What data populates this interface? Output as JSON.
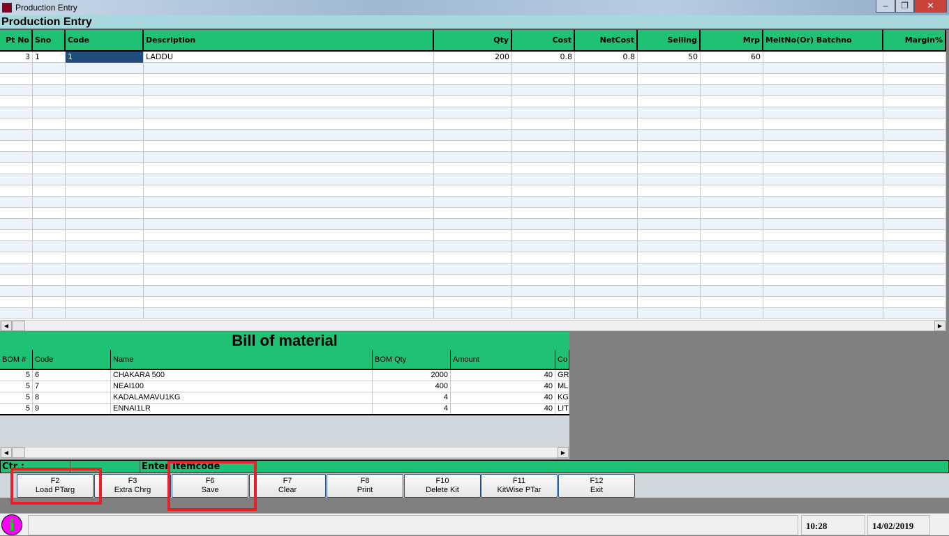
{
  "window": {
    "title": "Production Entry",
    "icon": "app-icon",
    "controls": [
      "minimize",
      "restore",
      "close"
    ]
  },
  "header": {
    "title": "Production Entry"
  },
  "grid": {
    "columns": [
      "Pt No",
      "Sno",
      "Code",
      "Description",
      "Qty",
      "Cost",
      "NetCost",
      "Selling",
      "Mrp",
      "MeltNo(Or) Batchno",
      "Margin%"
    ],
    "rows": [
      {
        "pt_no": "3",
        "sno": "1",
        "code": "1",
        "description": "LADDU",
        "qty": "200",
        "cost": "0.8",
        "net_cost": "0.8",
        "selling": "50",
        "mrp": "60",
        "batchno": "",
        "margin": ""
      }
    ]
  },
  "bom": {
    "title": "Bill of material",
    "columns": [
      "BOM #",
      "Code",
      "Name",
      "BOM Qty",
      "Amount",
      "Co"
    ],
    "rows": [
      {
        "bom": "5",
        "code": "6",
        "name": "CHAKARA 500",
        "qty": "2000",
        "amount": "40",
        "unit": "GR"
      },
      {
        "bom": "5",
        "code": "7",
        "name": "NEAI100",
        "qty": "400",
        "amount": "40",
        "unit": "ML"
      },
      {
        "bom": "5",
        "code": "8",
        "name": "KADALAMAVU1KG",
        "qty": "4",
        "amount": "40",
        "unit": "KG"
      },
      {
        "bom": "5",
        "code": "9",
        "name": "ENNAI1LR",
        "qty": "4",
        "amount": "40",
        "unit": "LIT"
      }
    ]
  },
  "status": {
    "ctr": "Ctr :",
    "middle": "",
    "message": "Enter Itemcode"
  },
  "buttons": [
    {
      "key": "F2",
      "label": "Load PTarg"
    },
    {
      "key": "F3",
      "label": "Extra Chrg"
    },
    {
      "key": "F6",
      "label": "Save"
    },
    {
      "key": "F7",
      "label": "Clear"
    },
    {
      "key": "F8",
      "label": "Print"
    },
    {
      "key": "F10",
      "label": "Delete Kit"
    },
    {
      "key": "F11",
      "label": "KitWise PTar"
    },
    {
      "key": "F12",
      "label": "Exit"
    }
  ],
  "footer": {
    "icon": "info-icon",
    "time": "10:28",
    "date": "14/02/2019"
  },
  "colors": {
    "header_green": "#1fc274",
    "title_cyan": "#a7d8de",
    "highlight_red": "#e8202a",
    "selection": "#1f4e7e"
  }
}
